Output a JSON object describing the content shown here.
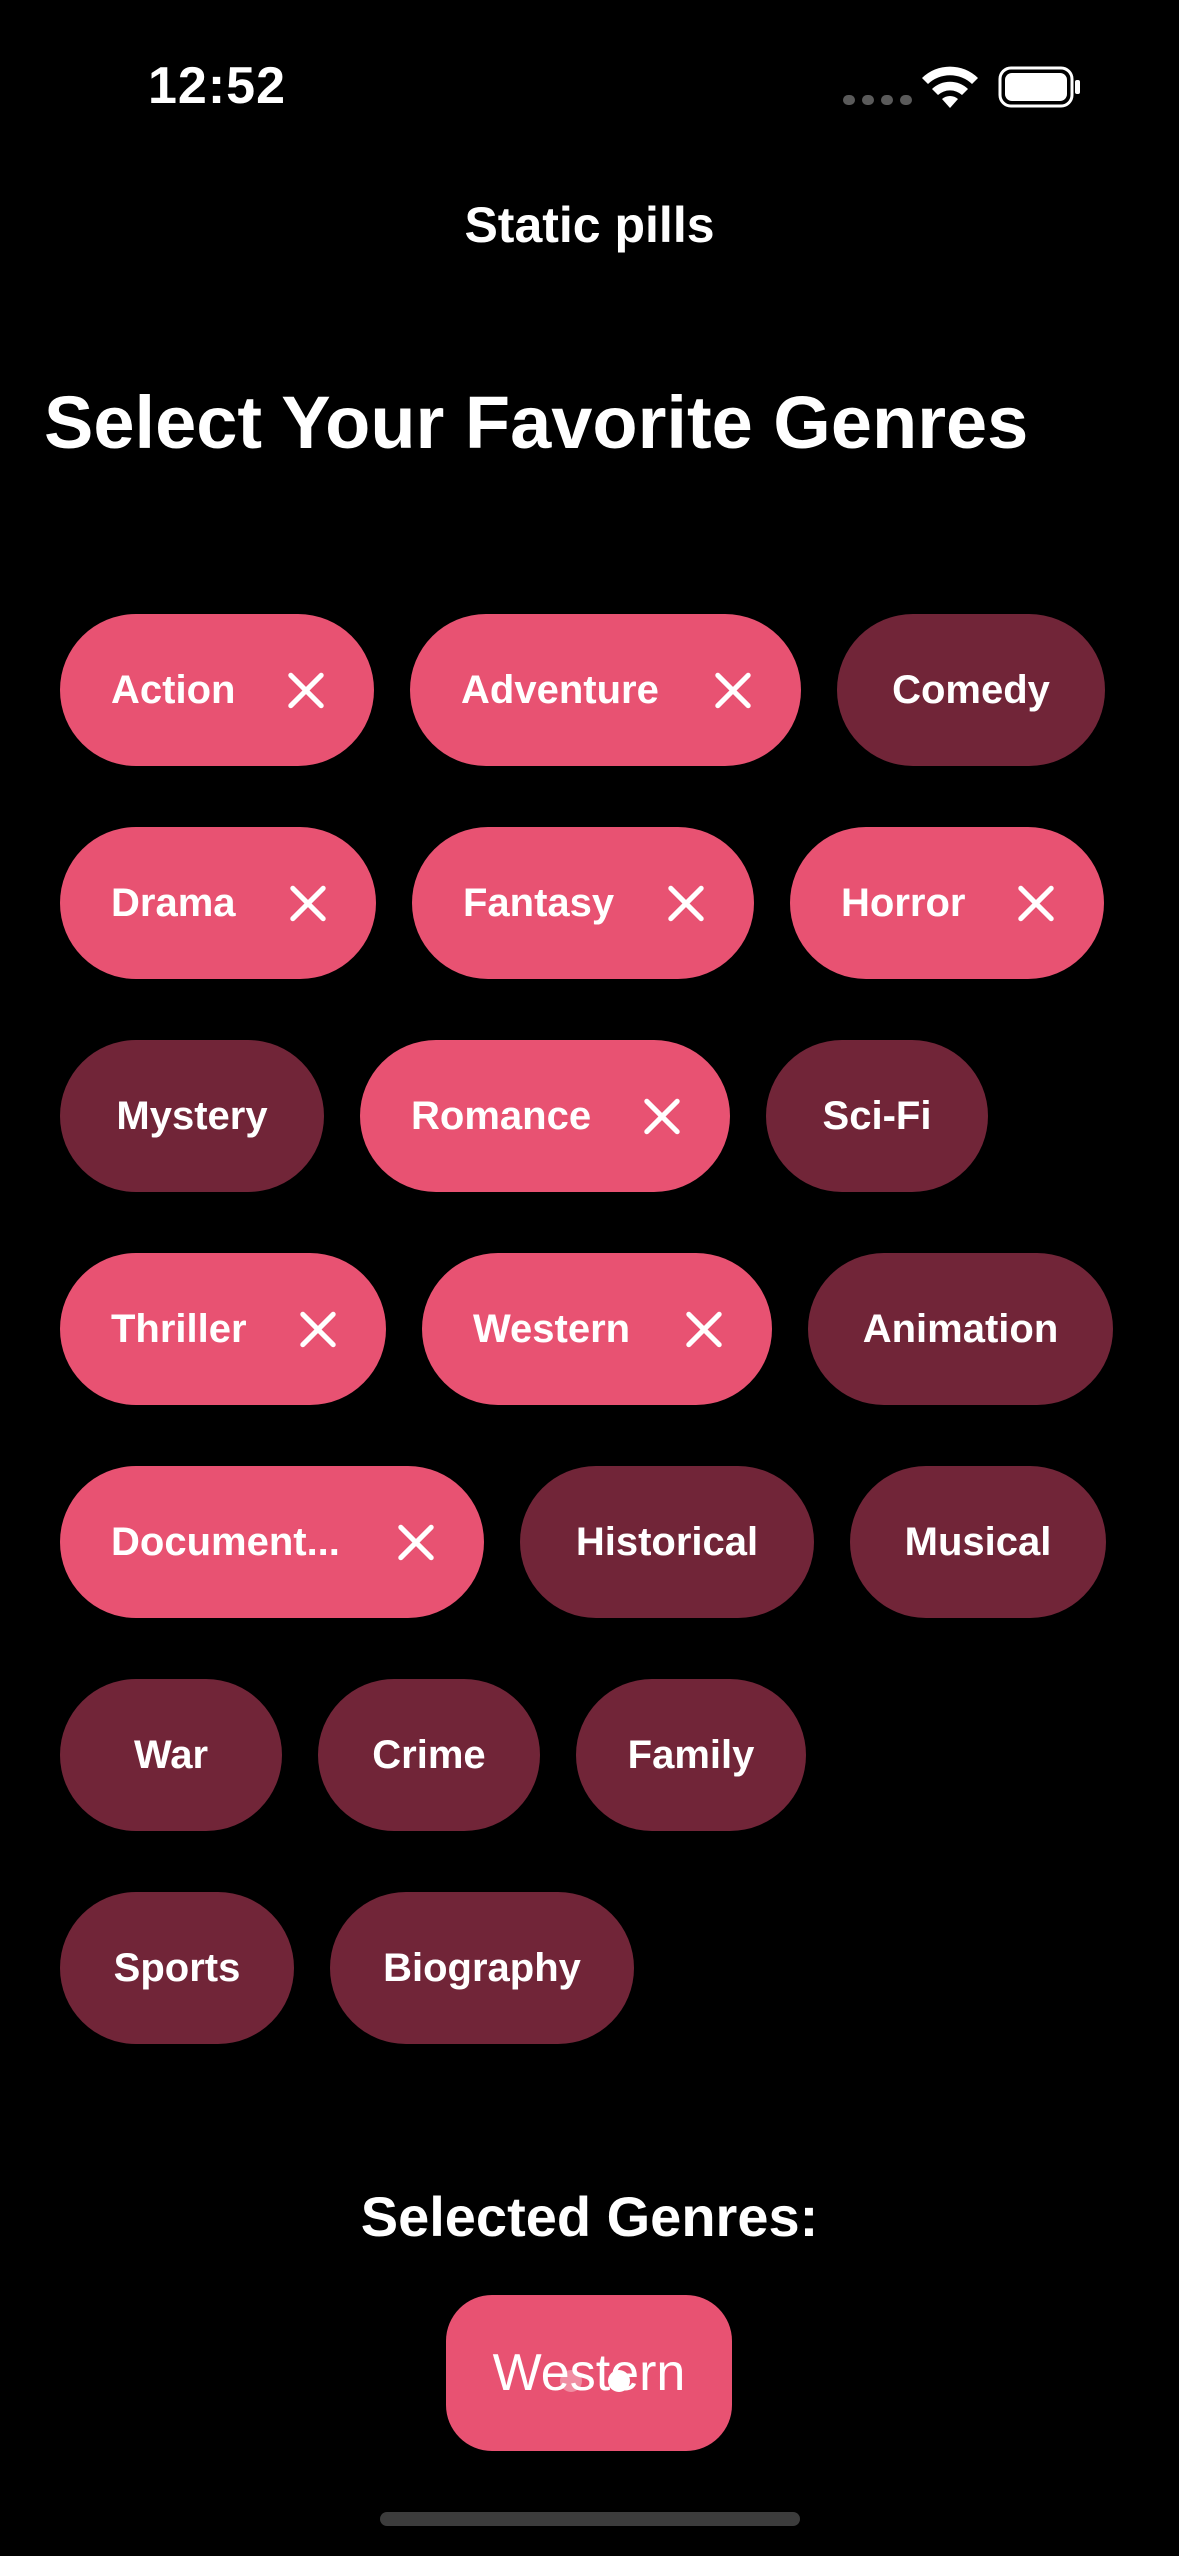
{
  "status_bar": {
    "time": "12:52"
  },
  "nav": {
    "title": "Static pills"
  },
  "heading": "Select Your Favorite Genres",
  "genres": [
    {
      "label": "Action",
      "selected": true
    },
    {
      "label": "Adventure",
      "selected": true
    },
    {
      "label": "Comedy",
      "selected": false
    },
    {
      "label": "Drama",
      "selected": true
    },
    {
      "label": "Fantasy",
      "selected": true
    },
    {
      "label": "Horror",
      "selected": true
    },
    {
      "label": "Mystery",
      "selected": false
    },
    {
      "label": "Romance",
      "selected": true
    },
    {
      "label": "Sci-Fi",
      "selected": false
    },
    {
      "label": "Thriller",
      "selected": true
    },
    {
      "label": "Western",
      "selected": true
    },
    {
      "label": "Animation",
      "selected": false
    },
    {
      "label": "Document...",
      "selected": true
    },
    {
      "label": "Historical",
      "selected": false
    },
    {
      "label": "Musical",
      "selected": false
    },
    {
      "label": "War",
      "selected": false
    },
    {
      "label": "Crime",
      "selected": false
    },
    {
      "label": "Family",
      "selected": false
    },
    {
      "label": "Sports",
      "selected": false
    },
    {
      "label": "Biography",
      "selected": false
    }
  ],
  "selected_section": {
    "title": "Selected Genres:",
    "current": "Western"
  },
  "colors": {
    "selected_pill": "#e85272",
    "unselected_pill": "#712538",
    "background": "#000000"
  }
}
